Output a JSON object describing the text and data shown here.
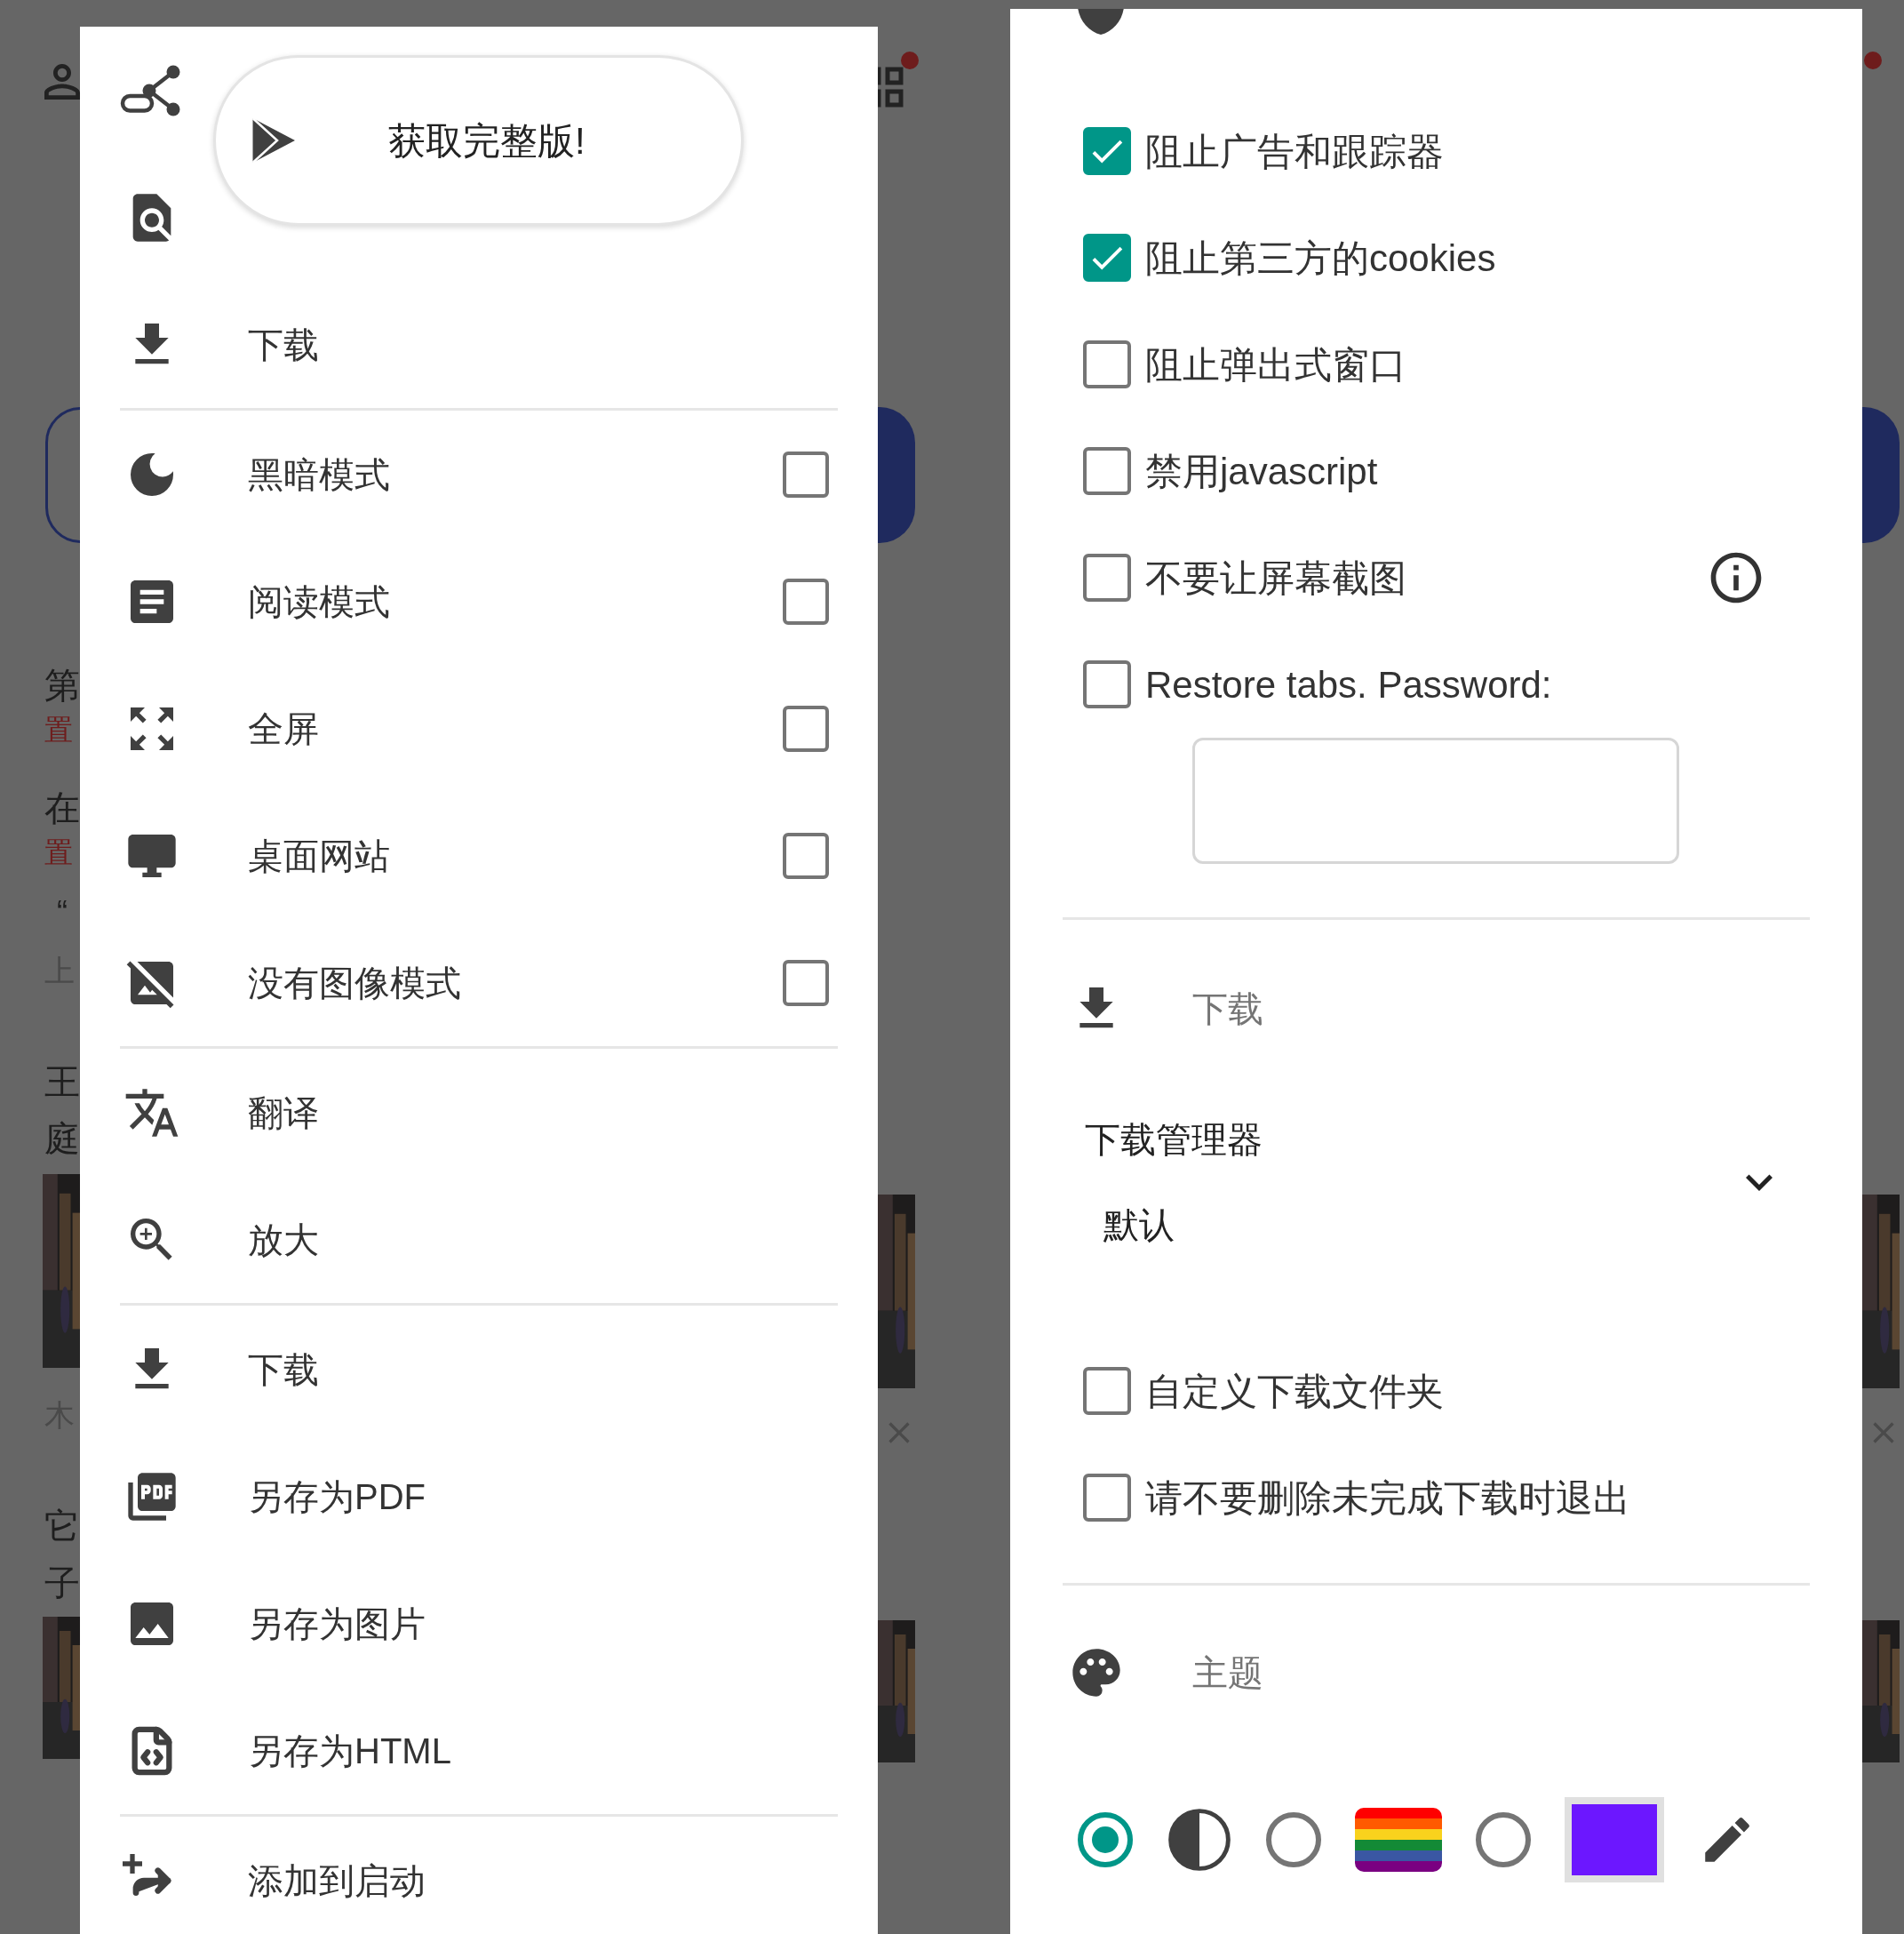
{
  "background": {
    "fragments": [
      {
        "text": "第",
        "kind": "title"
      },
      {
        "text": "置",
        "kind": "tag"
      },
      {
        "text": "在",
        "kind": "title"
      },
      {
        "text": "置",
        "kind": "tag"
      },
      {
        "text": "“",
        "kind": "title"
      },
      {
        "text": "上",
        "kind": "meta"
      },
      {
        "text": "王",
        "kind": "title"
      },
      {
        "text": "庭",
        "kind": "title"
      },
      {
        "text": "木",
        "kind": "meta"
      },
      {
        "text": "它",
        "kind": "title"
      },
      {
        "text": "子",
        "kind": "title"
      }
    ]
  },
  "menu": {
    "promo": {
      "label": "获取完整版!"
    },
    "sections": [
      {
        "items": [
          {
            "kind": "action"
          },
          {
            "kind": "action"
          },
          {
            "kind": "action",
            "label": "下载"
          }
        ]
      },
      {
        "items": [
          {
            "kind": "toggle",
            "label": "黑暗模式",
            "checked": false
          },
          {
            "kind": "toggle",
            "label": "阅读模式",
            "checked": false
          },
          {
            "kind": "toggle",
            "label": "全屏",
            "checked": false
          },
          {
            "kind": "toggle",
            "label": "桌面网站",
            "checked": false
          },
          {
            "kind": "toggle",
            "label": "没有图像模式",
            "checked": false
          }
        ]
      },
      {
        "items": [
          {
            "kind": "action",
            "label": "翻译"
          },
          {
            "kind": "action",
            "label": "放大"
          }
        ]
      },
      {
        "items": [
          {
            "kind": "action",
            "label": "下载"
          },
          {
            "kind": "action",
            "label": "另存为PDF"
          },
          {
            "kind": "action",
            "label": "另存为图片"
          },
          {
            "kind": "action",
            "label": "另存为HTML"
          }
        ]
      },
      {
        "items": [
          {
            "kind": "action",
            "label": "添加到启动"
          }
        ]
      }
    ]
  },
  "settings": {
    "privacy": {
      "options": [
        {
          "label": "阻止广告和跟踪器",
          "checked": true,
          "info": false
        },
        {
          "label": "阻止第三方的cookies",
          "checked": true,
          "info": false
        },
        {
          "label": "阻止弹出式窗口",
          "checked": false,
          "info": false
        },
        {
          "label": "禁用javascript",
          "checked": false,
          "info": false
        },
        {
          "label": "不要让屏幕截图",
          "checked": false,
          "info": true
        },
        {
          "label": "Restore tabs. Password:",
          "checked": false,
          "info": false
        }
      ]
    },
    "download": {
      "title": "下载",
      "manager": {
        "label": "下载管理器",
        "value": "默认"
      },
      "options": [
        {
          "label": "自定义下载文件夹",
          "checked": false
        },
        {
          "label": "请不要删除未完成下载时退出",
          "checked": false
        }
      ]
    },
    "theme": {
      "title": "主题",
      "options": [
        {
          "kind": "radio",
          "selected": true
        },
        {
          "kind": "contrast",
          "selected": false
        },
        {
          "kind": "radio",
          "selected": false
        },
        {
          "kind": "rainbow",
          "selected": false
        },
        {
          "kind": "radio",
          "selected": false
        },
        {
          "kind": "custom",
          "color": "#6c17ff",
          "selected": false
        },
        {
          "kind": "edit"
        }
      ]
    }
  }
}
